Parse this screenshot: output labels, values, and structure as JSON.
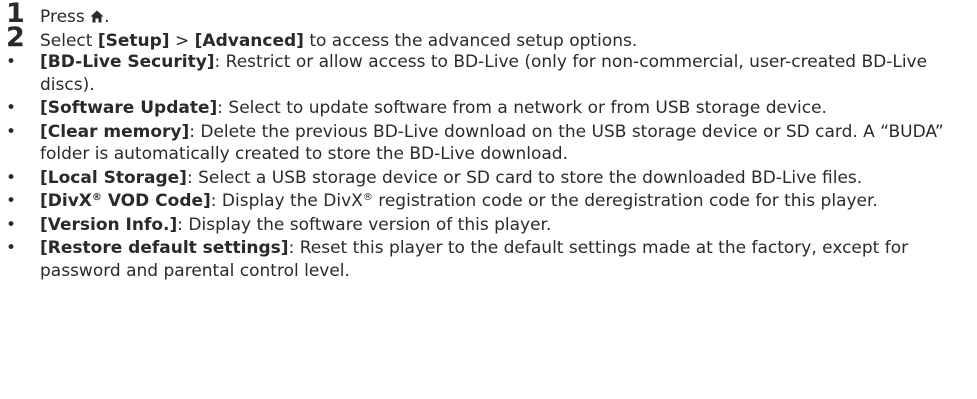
{
  "steps": [
    {
      "number": "1",
      "text_before": "Press ",
      "icon": "home-icon",
      "text_after": "."
    },
    {
      "number": "2",
      "text_before": "Select ",
      "menu_setup": "[Setup]",
      "separator": " > ",
      "menu_advanced": "[Advanced]",
      "text_after": " to access the advanced setup options."
    }
  ],
  "options": [
    {
      "term": "[BD-Live Security]",
      "description": ": Restrict or allow access to BD-Live (only for non-commercial, user-created BD-Live discs)."
    },
    {
      "term": "[Software Update]",
      "description": ": Select to update software from a network or from USB storage device."
    },
    {
      "term": "[Clear memory]",
      "description": ": Delete the previous BD-Live download on the USB storage device or SD card. A “BUDA” folder is automatically created to store the BD-Live download."
    },
    {
      "term": "[Local Storage]",
      "description": ": Select a USB storage device or SD card to store the downloaded BD-Live files."
    },
    {
      "term_prefix": "[DivX",
      "term_sup": "®",
      "term_suffix": " VOD Code]",
      "description_prefix": ": Display the DivX",
      "description_sup": "®",
      "description_suffix": " registration code or the deregistration code for this player."
    },
    {
      "term": "[Version Info.]",
      "description": ": Display the software version of this player."
    },
    {
      "term": "[Restore default settings]",
      "description": ": Reset this player to the default settings made at the factory, except for password and parental control level."
    }
  ],
  "bullet_symbol": "•"
}
